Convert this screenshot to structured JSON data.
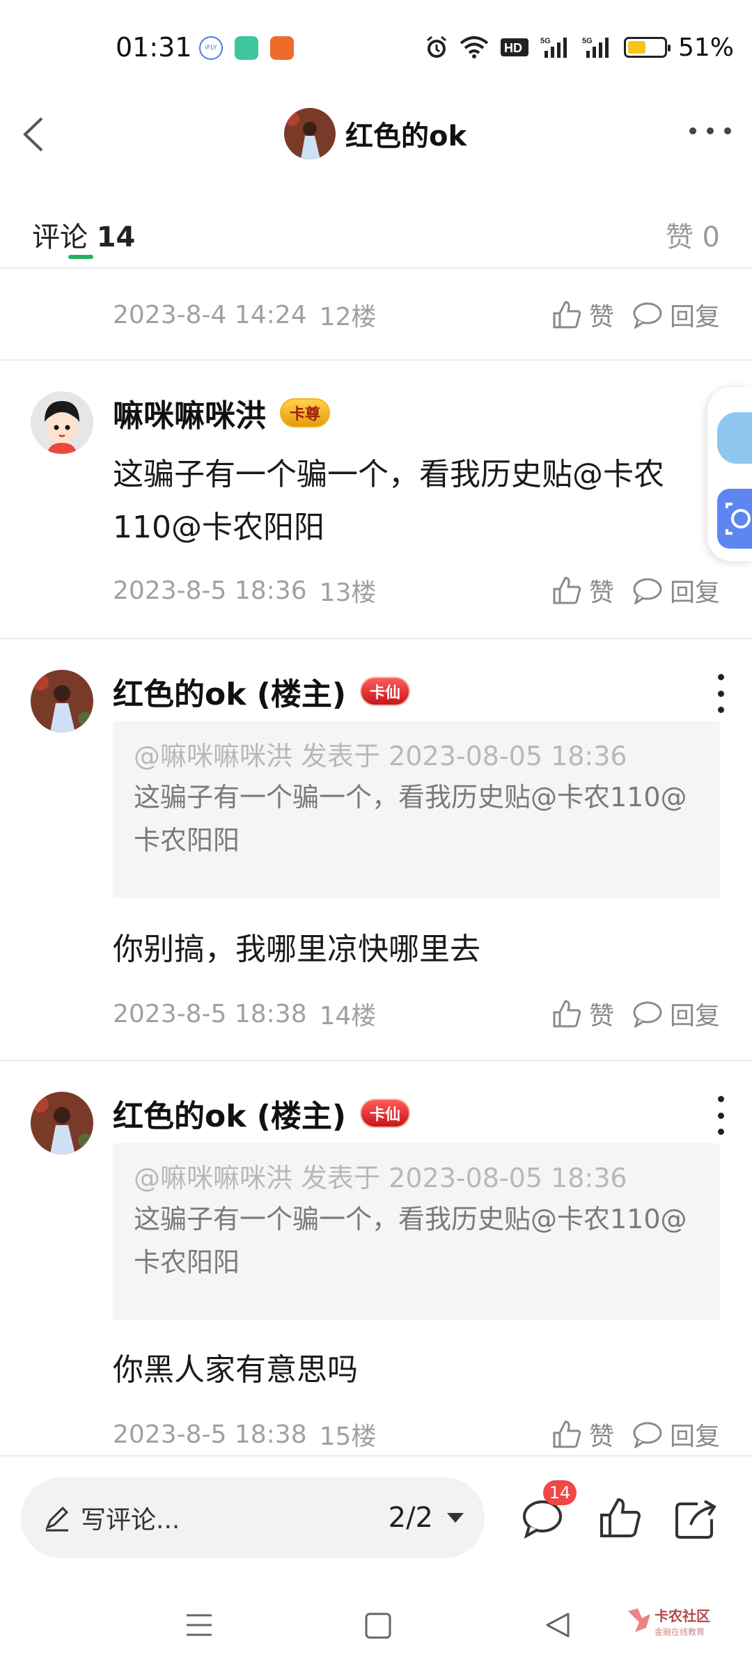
{
  "status_bar": {
    "time": "01:31",
    "battery_percent": "51%",
    "battery_level": 0.51,
    "icons": [
      "ifly-icon",
      "shield-app-icon",
      "grid-app-icon",
      "alarm-icon",
      "wifi-icon",
      "hd-icon",
      "signal-5g-icon",
      "signal-5g-icon"
    ]
  },
  "header": {
    "title": "红色的ok",
    "back_icon": "chevron-left-icon",
    "more_icon": "more-horizontal-icon"
  },
  "tabs": {
    "comments_label": "评论",
    "comments_count": "14",
    "likes_label": "赞 0"
  },
  "actions": {
    "like": "赞",
    "reply": "回复"
  },
  "prev_post": {
    "date": "2023-8-4 14:24",
    "floor": "12楼"
  },
  "posts": [
    {
      "author": "嘛咪嘛咪洪",
      "badge": "卡尊",
      "body": "这骗子有一个骗一个，看我历史贴@卡农110@卡农阳阳",
      "date": "2023-8-5 18:36",
      "floor": "13楼"
    },
    {
      "author": "红色的ok (楼主)",
      "badge": "卡仙",
      "quote_head": "@嘛咪嘛咪洪 发表于 2023-08-05 18:36",
      "quote_text": "这骗子有一个骗一个，看我历史贴@卡农110@卡农阳阳",
      "body": "你别搞，我哪里凉快哪里去",
      "date": "2023-8-5 18:38",
      "floor": "14楼"
    },
    {
      "author": "红色的ok (楼主)",
      "badge": "卡仙",
      "quote_head": "@嘛咪嘛咪洪 发表于 2023-08-05 18:36",
      "quote_text": "这骗子有一个骗一个，看我历史贴@卡农110@卡农阳阳",
      "body": "你黑人家有意思吗",
      "date": "2023-8-5 18:38",
      "floor": "15楼"
    }
  ],
  "bottom_bar": {
    "placeholder": "写评论...",
    "page_indicator": "2/2",
    "comment_count": "14"
  },
  "watermark": {
    "text": "卡农社区",
    "subtext": "金融在线教育"
  },
  "colors": {
    "accent_green": "#22b35e",
    "badge_red": "#f04747",
    "muted_text": "#a0a0a0"
  }
}
